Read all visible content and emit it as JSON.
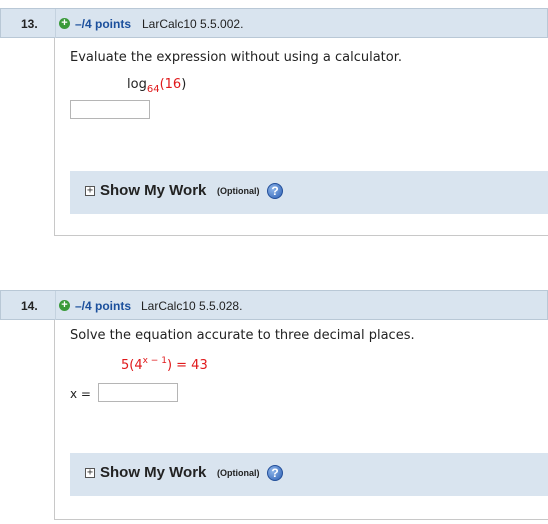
{
  "questions": [
    {
      "number": "13.",
      "plus": "+",
      "points": "–/4 points",
      "source": "LarCalc10 5.5.002.",
      "prompt": "Evaluate the expression without using a calculator.",
      "expression": {
        "func": "log",
        "base": "64",
        "open": "(",
        "arg": "16",
        "close": ")"
      },
      "answer_value": "",
      "show_my_work": {
        "toggle": "+",
        "label": "Show My Work",
        "optional": "(Optional)",
        "help": "?"
      }
    },
    {
      "number": "14.",
      "plus": "+",
      "points": "–/4 points",
      "source": "LarCalc10 5.5.028.",
      "prompt": "Solve the equation accurate to three decimal places.",
      "equation": {
        "coef": "5(4",
        "exponent": "x − 1",
        "rest": ") = 43"
      },
      "answer_label": "x =",
      "answer_value": "",
      "show_my_work": {
        "toggle": "+",
        "label": "Show My Work",
        "optional": "(Optional)",
        "help": "?"
      }
    }
  ],
  "colors": {
    "header_bg": "#d9e4ef",
    "points_blue": "#1b4f9c",
    "math_red": "#e0191b",
    "plus_green": "#3a9a3a",
    "help_blue": "#2c5fb4"
  },
  "icons": {
    "plus": "plus-circle-icon",
    "expand": "expand-box-icon",
    "help": "help-icon"
  }
}
